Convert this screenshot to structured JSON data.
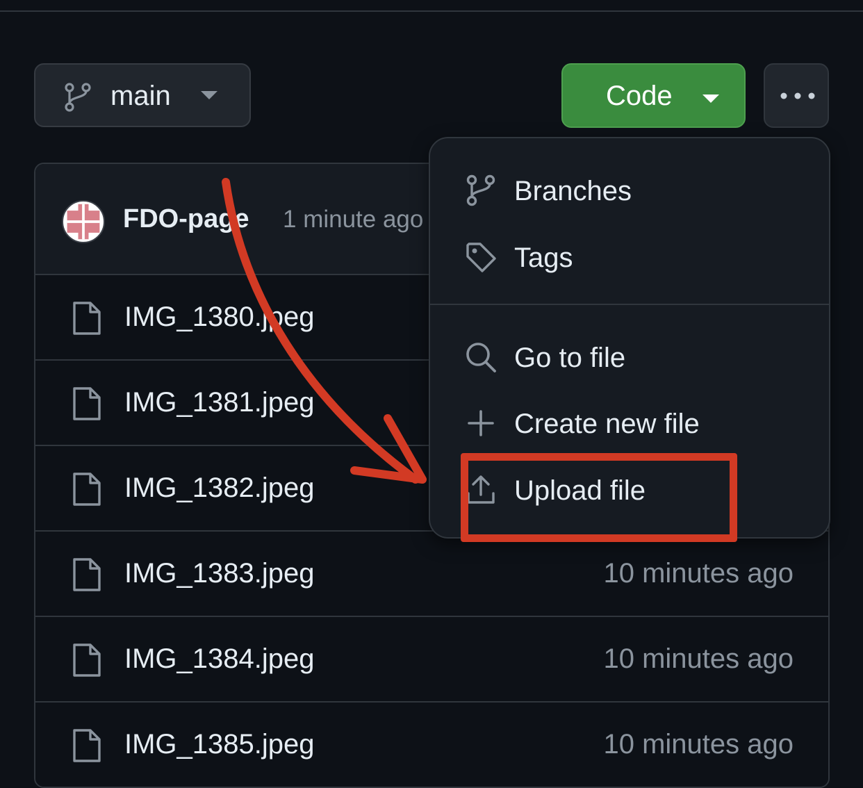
{
  "branch": {
    "label": "main"
  },
  "code_button": {
    "label": "Code"
  },
  "latest_commit": {
    "author": "FDO-page",
    "time": "1 minute ago"
  },
  "files": [
    {
      "name": "IMG_1380.jpeg",
      "time": ""
    },
    {
      "name": "IMG_1381.jpeg",
      "time": ""
    },
    {
      "name": "IMG_1382.jpeg",
      "time": ""
    },
    {
      "name": "IMG_1383.jpeg",
      "time": "10 minutes ago"
    },
    {
      "name": "IMG_1384.jpeg",
      "time": "10 minutes ago"
    },
    {
      "name": "IMG_1385.jpeg",
      "time": "10 minutes ago"
    }
  ],
  "menu": {
    "items": [
      {
        "label": "Branches",
        "icon": "git-branch-icon"
      },
      {
        "label": "Tags",
        "icon": "tag-icon"
      },
      {
        "label": "Go to file",
        "icon": "search-icon"
      },
      {
        "label": "Create new file",
        "icon": "plus-icon"
      },
      {
        "label": "Upload file",
        "icon": "upload-icon"
      }
    ]
  },
  "colors": {
    "background": "#0d1117",
    "code_button": "#3a8c3e",
    "annotation": "#d23a24"
  }
}
